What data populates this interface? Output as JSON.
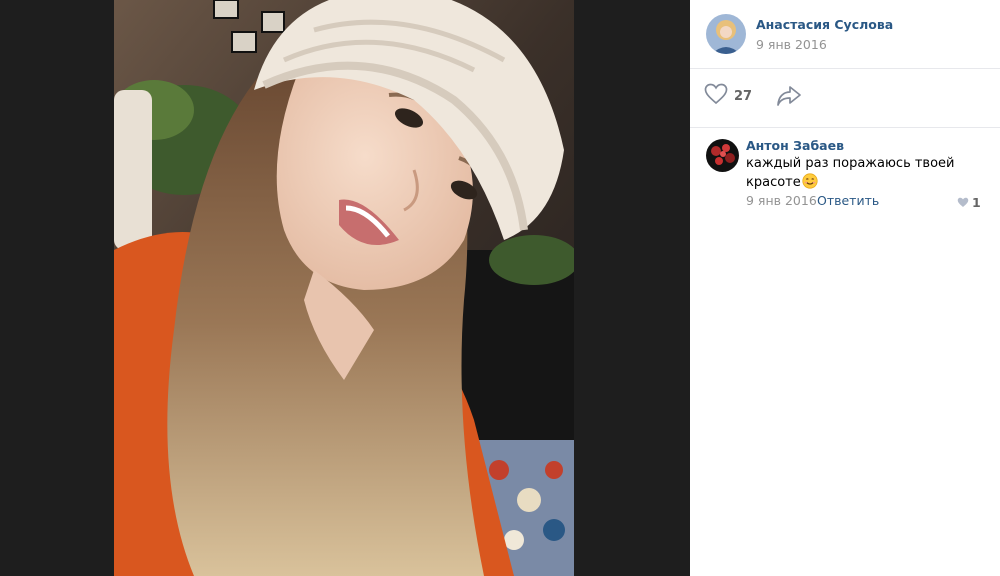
{
  "post": {
    "author_name": "Анастасия Суслова",
    "date": "9 янв 2016",
    "avatar_icon": "user-avatar-icon"
  },
  "actions": {
    "like_count": "27",
    "like_icon": "heart-icon",
    "share_icon": "share-arrow-icon"
  },
  "comments": [
    {
      "author": "Антон Забаев",
      "text": "каждый раз поражаюсь твоей красоте",
      "emoji": "smiling-face-emoji",
      "date": "9 янв 2016",
      "reply_label": "Ответить",
      "like_count": "1"
    }
  ],
  "colors": {
    "link": "#2a5885",
    "meta": "#939393",
    "photo_background": "#1e1e1e",
    "divider": "#e7e8ec"
  }
}
